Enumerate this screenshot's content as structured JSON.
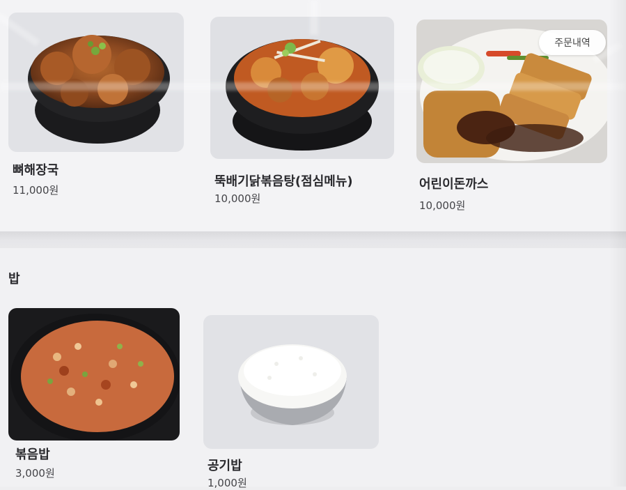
{
  "menu_top": [
    {
      "name": "뼈해장국",
      "price": "11,000원",
      "photo": "pork-bone-soup-photo"
    },
    {
      "name": "뚝배기닭볶음탕(점심메뉴)",
      "price": "10,000원",
      "photo": "braised-chicken-pot-photo"
    },
    {
      "name": "어린이돈까스",
      "price": "10,000원",
      "photo": "kids-pork-cutlet-photo"
    }
  ],
  "order_history_label": "주문내역",
  "rice_section": {
    "title": "밥",
    "items": [
      {
        "name": "볶음밥",
        "price": "3,000원",
        "photo": "fried-rice-photo"
      },
      {
        "name": "공기밥",
        "price": "1,000원",
        "photo": "steamed-rice-bowl-photo"
      }
    ]
  },
  "colors": {
    "background": "#f2f2f4",
    "text": "#2a2a2e",
    "divider": "#d9d9dc"
  }
}
